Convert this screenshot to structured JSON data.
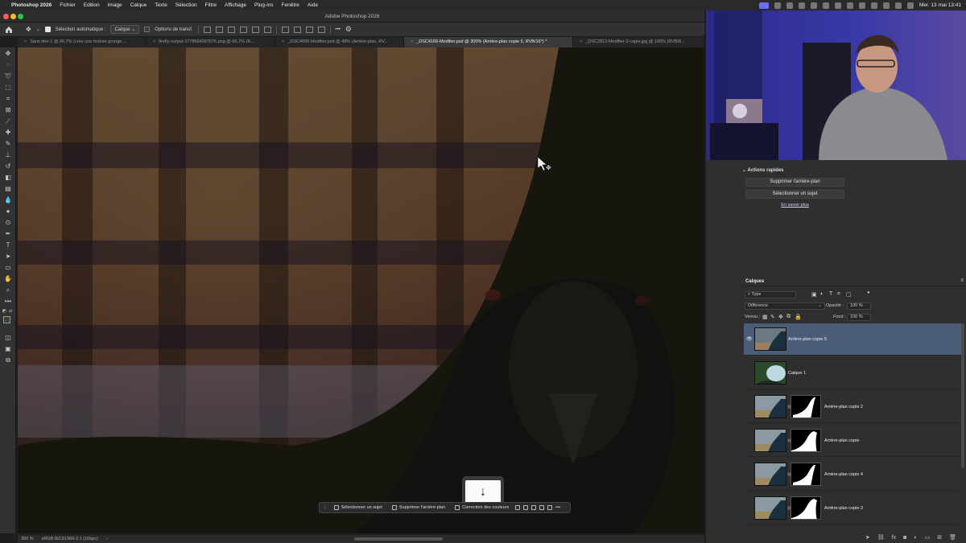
{
  "menubar": {
    "app": "Photoshop 2026",
    "items": [
      "Fichier",
      "Edition",
      "Image",
      "Calque",
      "Texte",
      "Sélection",
      "Filtre",
      "Affichage",
      "Plug-ins",
      "Fenêtre",
      "Aide"
    ],
    "clock": "Mer. 13 mai 13:41"
  },
  "window": {
    "title": "Adobe Photoshop 2026"
  },
  "options": {
    "auto_select_label": "Sélection automatique :",
    "auto_select_value": "Calque",
    "transform_label": "Options de transf."
  },
  "tabs": [
    "Sans titre-1 @ 66,7% (crée une texture grunge ...",
    "firefly-output-1778664997676.png @ 66,7% (R...",
    "_DSC4690-Modifier.psd @ 48% (Arrière-plan, RV...",
    "_DSC4166-Modifier.psd @ 300% (Arrière-plan copie 5, RVB/16*) *",
    "_DSC2813-Modifier-2-copie.jpg @ 100% (RVB/8..."
  ],
  "status": {
    "zoom": "300 %",
    "profile": "sRGB IEC61966-2.1 (16bpc)",
    "arrow": "›"
  },
  "contextbar": {
    "select_subject": "Sélectionner un sujet",
    "remove_bg": "Supprimer l'arrière-plan",
    "color_correction": "Correction des couleurs",
    "more": "•••"
  },
  "download_icon": "↓",
  "quick_actions": {
    "title": "Actions rapides",
    "remove_bg": "Supprimer l'arrière-plan",
    "select_subject": "Sélectionner un sujet",
    "learn_more": "En savoir plus"
  },
  "layers_panel": {
    "title": "Calques",
    "filter": "Type",
    "blend_mode": "Différence",
    "opacity_label": "Opacité :",
    "opacity_value": "100 %",
    "lock_label": "Verrou :",
    "fill_label": "Fond :",
    "fill_value": "100 %",
    "layers": [
      {
        "name": "Arrière-plan copie 5",
        "selected": true,
        "visible": true,
        "mask": false
      },
      {
        "name": "Calque 1",
        "selected": false,
        "visible": false,
        "mask": false
      },
      {
        "name": "Arrière-plan copie 2",
        "selected": false,
        "visible": false,
        "mask": true
      },
      {
        "name": "Arrière-plan copie",
        "selected": false,
        "visible": false,
        "mask": true
      },
      {
        "name": "Arrière-plan copie 4",
        "selected": false,
        "visible": false,
        "mask": true
      },
      {
        "name": "Arrière-plan copie 3",
        "selected": false,
        "visible": false,
        "mask": true
      }
    ]
  },
  "colors": {
    "accent_selection": "#4a5c78",
    "link": "#cfd8ff"
  }
}
